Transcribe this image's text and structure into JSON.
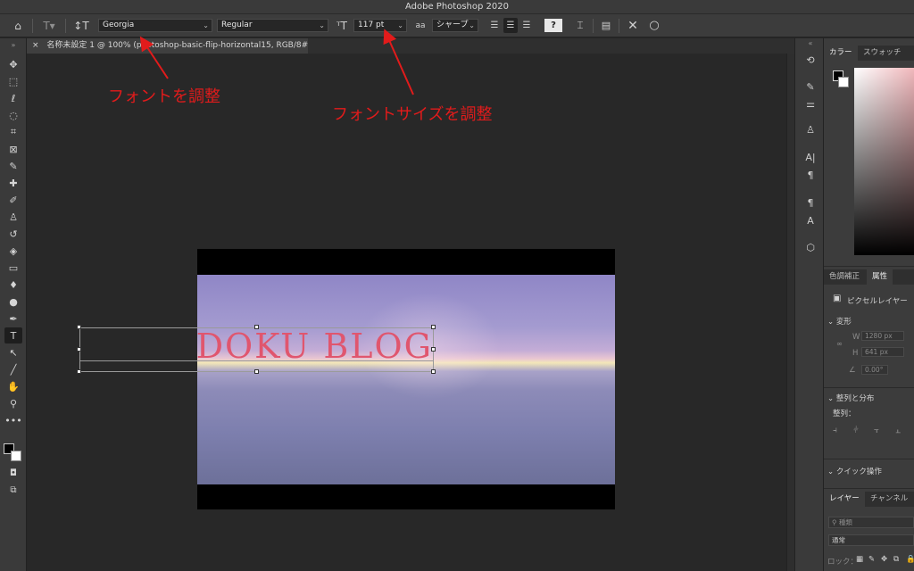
{
  "app": {
    "title": "Adobe Photoshop 2020"
  },
  "options_bar": {
    "font_family": "Georgia",
    "font_style": "Regular",
    "font_size": "117 pt",
    "antialias": "シャープ",
    "antialias_icon": "aa",
    "warp_icon": "?"
  },
  "document_tab": {
    "label": "名称未設定 1 @ 100% (photoshop-basic-flip-horizontal15, RGB/8#) *",
    "close": "×"
  },
  "canvas": {
    "text_layer": "DOKU BLOG"
  },
  "annotations": {
    "font_label": "フォントを調整",
    "size_label": "フォントサイズを調整",
    "color": "#e21b1b"
  },
  "panels": {
    "color_tabs": [
      "カラー",
      "スウォッチ"
    ],
    "properties_tabs": [
      "色調補正",
      "属性"
    ],
    "layer_type": "ピクセルレイヤー",
    "transform": {
      "header": "変形",
      "w_label": "W",
      "w_value": "1280 px",
      "h_label": "H",
      "h_value": "641 px",
      "angle_value": "0.00°"
    },
    "align": {
      "header": "整列と分布",
      "sub": "整列："
    },
    "quick_actions": "クイック操作",
    "layers_tabs": [
      "レイヤー",
      "チャンネル"
    ],
    "layers_search": "種類",
    "blend_mode": "通常",
    "lock_label": "ロック："
  },
  "colors": {
    "accent_text": "#e0566e",
    "ui_bg": "#3c3c3c"
  }
}
